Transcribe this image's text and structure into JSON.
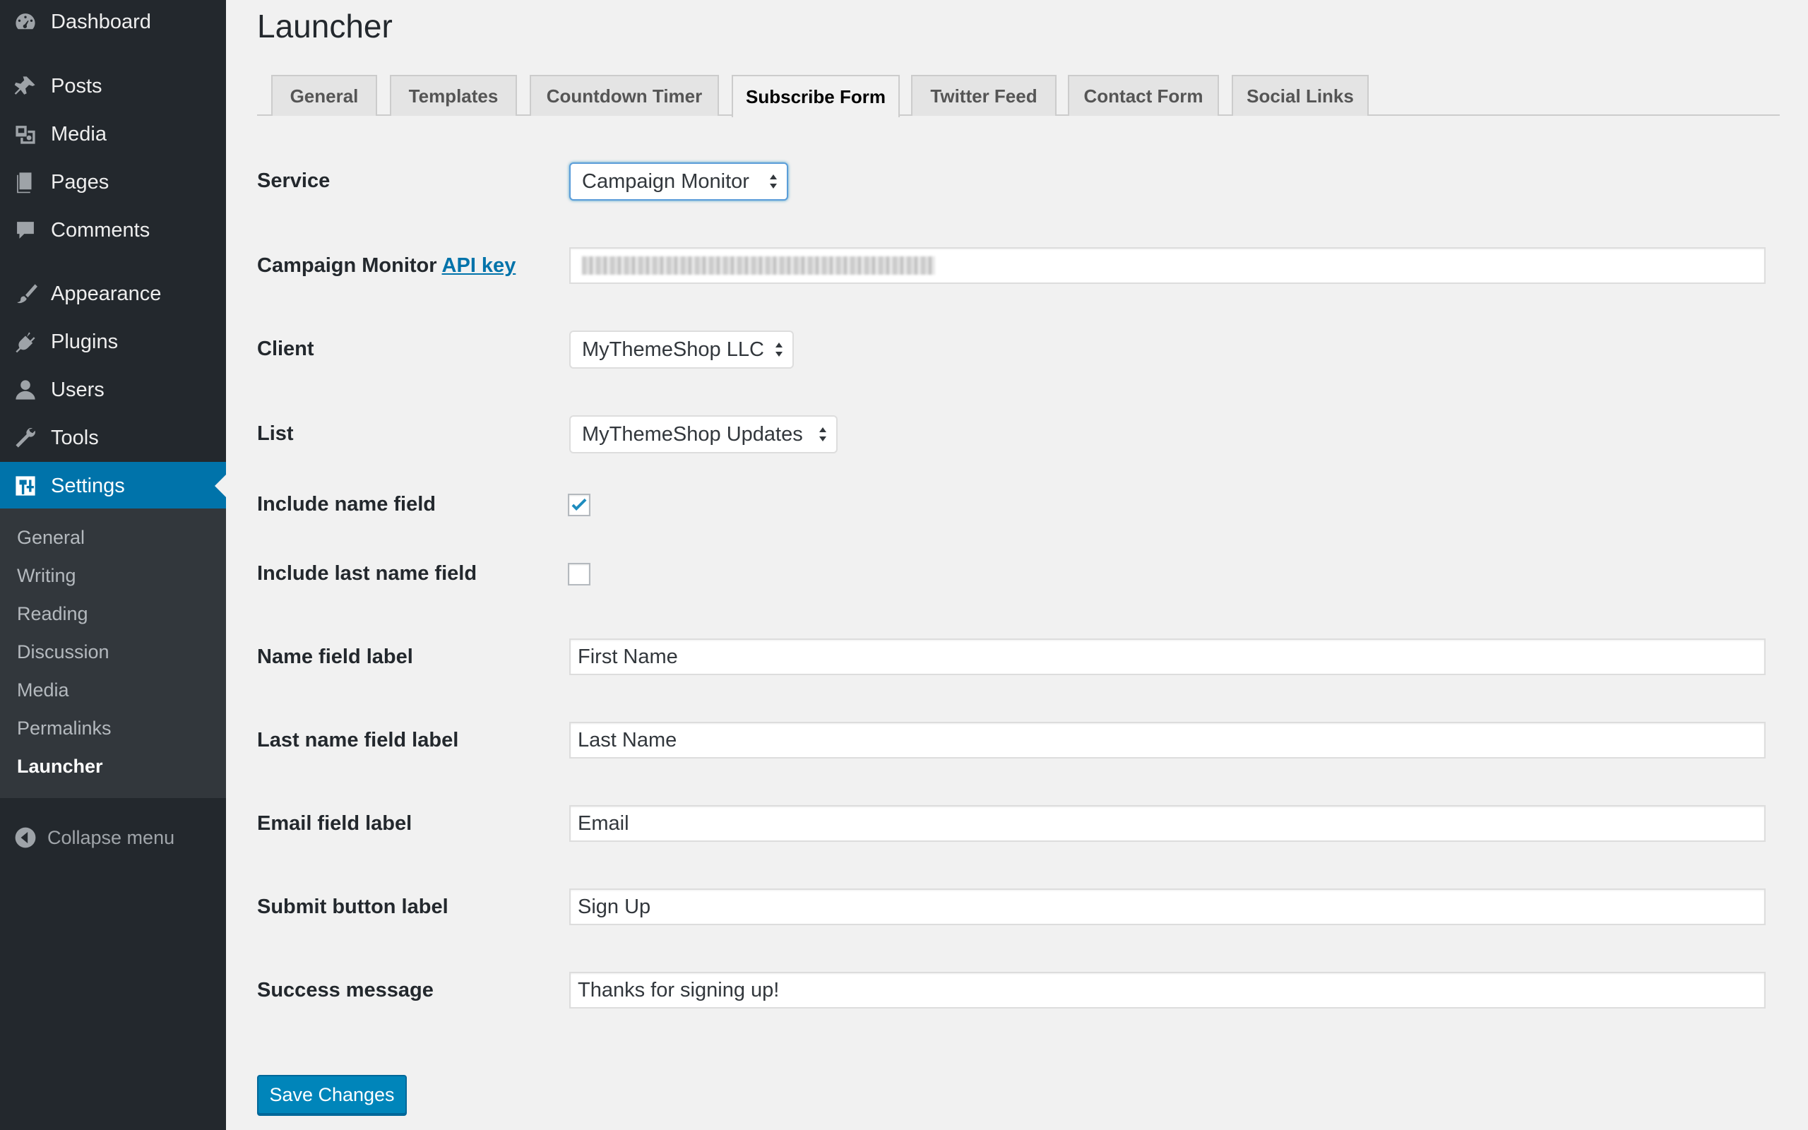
{
  "sidebar": {
    "items": [
      {
        "label": "Dashboard",
        "icon": "dashboard-icon"
      },
      {
        "label": "Posts",
        "icon": "pushpin-icon"
      },
      {
        "label": "Media",
        "icon": "media-icon"
      },
      {
        "label": "Pages",
        "icon": "pages-icon"
      },
      {
        "label": "Comments",
        "icon": "comment-bubble-icon"
      },
      {
        "label": "Appearance",
        "icon": "paintbrush-icon"
      },
      {
        "label": "Plugins",
        "icon": "plugin-icon"
      },
      {
        "label": "Users",
        "icon": "user-icon"
      },
      {
        "label": "Tools",
        "icon": "wrench-icon"
      },
      {
        "label": "Settings",
        "icon": "settings-icon",
        "active": true
      }
    ],
    "submenu": [
      "General",
      "Writing",
      "Reading",
      "Discussion",
      "Media",
      "Permalinks",
      "Launcher"
    ],
    "current_submenu": "Launcher",
    "collapse_label": "Collapse menu"
  },
  "page": {
    "title": "Launcher"
  },
  "tabs": [
    "General",
    "Templates",
    "Countdown Timer",
    "Subscribe Form",
    "Twitter Feed",
    "Contact Form",
    "Social Links"
  ],
  "active_tab": "Subscribe Form",
  "form": {
    "service": {
      "label": "Service",
      "value": "Campaign Monitor"
    },
    "api_key": {
      "label_prefix": "Campaign Monitor",
      "link_text": "API key",
      "value": "(blurred)"
    },
    "client": {
      "label": "Client",
      "value": "MyThemeShop LLC"
    },
    "list": {
      "label": "List",
      "value": "MyThemeShop Updates"
    },
    "include_name": {
      "label": "Include name field",
      "checked": true
    },
    "include_last_name": {
      "label": "Include last name field",
      "checked": false
    },
    "name_label": {
      "label": "Name field label",
      "value": "First Name"
    },
    "last_name_label": {
      "label": "Last name field label",
      "value": "Last Name"
    },
    "email_label": {
      "label": "Email field label",
      "value": "Email"
    },
    "submit_label": {
      "label": "Submit button label",
      "value": "Sign Up"
    },
    "success_message": {
      "label": "Success message",
      "value": "Thanks for signing up!"
    }
  },
  "save_button": "Save Changes",
  "colors": {
    "sidebar_bg": "#23282d",
    "submenu_bg": "#32373c",
    "accent": "#0073aa",
    "button": "#0085ba",
    "page_bg": "#f1f1f1"
  }
}
